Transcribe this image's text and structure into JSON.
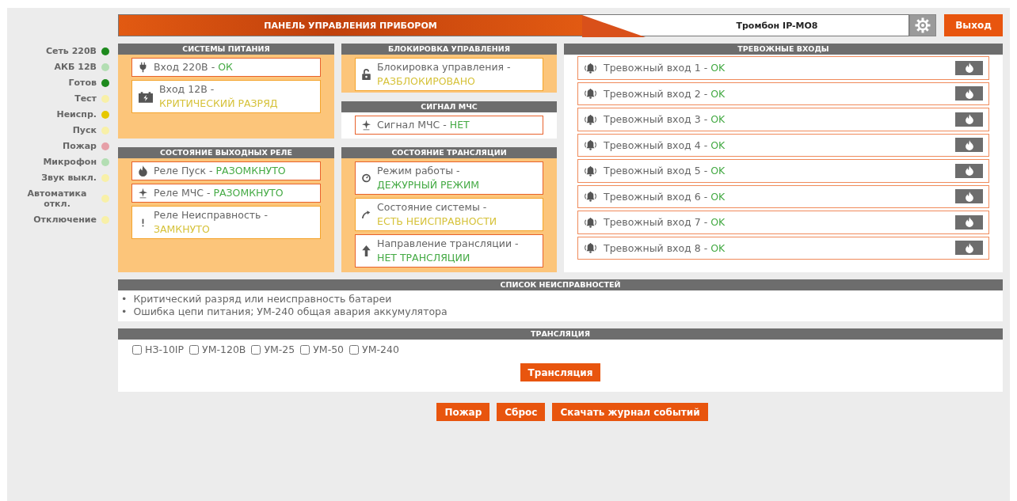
{
  "indicators": [
    {
      "label": "Сеть 220В",
      "color": "#1e8a1e"
    },
    {
      "label": "АКБ 12В",
      "color": "#b3deb3"
    },
    {
      "label": "Готов",
      "color": "#1e8a1e"
    },
    {
      "label": "Тест",
      "color": "#f8f0a8"
    },
    {
      "label": "Неиспр.",
      "color": "#e6c800"
    },
    {
      "label": "Пуск",
      "color": "#f8f0a8"
    },
    {
      "label": "Пожар",
      "color": "#e6a0a8"
    },
    {
      "label": "Микрофон",
      "color": "#b3deb3"
    },
    {
      "label": "Звук выкл.",
      "color": "#f8f0a8"
    },
    {
      "label": "Автоматика откл.",
      "color": "#f8f0a8"
    },
    {
      "label": "Отключение",
      "color": "#f8f0a8"
    }
  ],
  "header": {
    "title": "ПАНЕЛЬ УПРАВЛЕНИЯ ПРИБОРОМ",
    "device": "Тромбон IP-MO8",
    "exit_button": "Выход"
  },
  "power": {
    "title": "СИСТЕМЫ ПИТАНИЯ",
    "items": [
      {
        "label": "Вход 220В -",
        "value": "ОК",
        "kind": "ok"
      },
      {
        "label": "Вход 12В -",
        "value": "КРИТИЧЕСКИЙ РАЗРЯД",
        "kind": "warn"
      }
    ]
  },
  "lock": {
    "title": "БЛОКИРОВКА УПРАВЛЕНИЯ",
    "items": [
      {
        "label": "Блокировка управления -",
        "value": "РАЗБЛОКИРОВАНО",
        "kind": "warn"
      }
    ]
  },
  "mchs": {
    "title": "СИГНАЛ МЧС",
    "items": [
      {
        "label": "Сигнал МЧС -",
        "value": "НЕТ",
        "kind": "ok"
      }
    ]
  },
  "relays": {
    "title": "СОСТОЯНИЕ ВЫХОДНЫХ РЕЛЕ",
    "items": [
      {
        "label": "Реле Пуск -",
        "value": "РАЗОМКНУТО",
        "kind": "ok"
      },
      {
        "label": "Реле МЧС -",
        "value": "РАЗОМКНУТО",
        "kind": "ok"
      },
      {
        "label": "Реле Неисправность -",
        "value": "ЗАМКНУТО",
        "kind": "warn"
      }
    ]
  },
  "broadcast_state": {
    "title": "СОСТОЯНИЕ ТРАНСЛЯЦИИ",
    "items": [
      {
        "label": "Режим работы -",
        "value": "ДЕЖУРНЫЙ РЕЖИМ",
        "kind": "ok"
      },
      {
        "label": "Состояние системы -",
        "value": "ЕСТЬ НЕИСПРАВНОСТИ",
        "kind": "warn"
      },
      {
        "label": "Направление трансляции -",
        "value": "НЕТ ТРАНСЛЯЦИИ",
        "kind": "ok"
      }
    ]
  },
  "alarm_inputs": {
    "title": "ТРЕВОЖНЫЕ ВХОДЫ",
    "items": [
      {
        "label": "Тревожный вход 1 -",
        "value": "OK",
        "kind": "ok"
      },
      {
        "label": "Тревожный вход 2 -",
        "value": "OK",
        "kind": "ok"
      },
      {
        "label": "Тревожный вход 3 -",
        "value": "OK",
        "kind": "ok"
      },
      {
        "label": "Тревожный вход 4 -",
        "value": "OK",
        "kind": "ok"
      },
      {
        "label": "Тревожный вход 5 -",
        "value": "OK",
        "kind": "ok"
      },
      {
        "label": "Тревожный вход 6 -",
        "value": "OK",
        "kind": "ok"
      },
      {
        "label": "Тревожный вход 7 -",
        "value": "OK",
        "kind": "ok"
      },
      {
        "label": "Тревожный вход 8 -",
        "value": "OK",
        "kind": "ok"
      }
    ]
  },
  "faults": {
    "title": "СПИСОК НЕИСПРАВНОСТЕЙ",
    "items": [
      {
        "marker": "•",
        "text": "Критический разряд или неисправность батареи"
      },
      {
        "marker": "•",
        "text": "Ошибка цепи питания; УМ-240 общая авария аккумулятора"
      }
    ]
  },
  "translation": {
    "title": "ТРАНСЛЯЦИЯ",
    "options": [
      {
        "label": "НЗ-10IP",
        "checked": false
      },
      {
        "label": "УМ-120В",
        "checked": false
      },
      {
        "label": "УМ-25",
        "checked": false
      },
      {
        "label": "УМ-50",
        "checked": false
      },
      {
        "label": "УМ-240",
        "checked": false
      }
    ],
    "button": "Трансляция"
  },
  "buttons": [
    "Пожар",
    "Сброс",
    "Скачать журнал событий"
  ]
}
